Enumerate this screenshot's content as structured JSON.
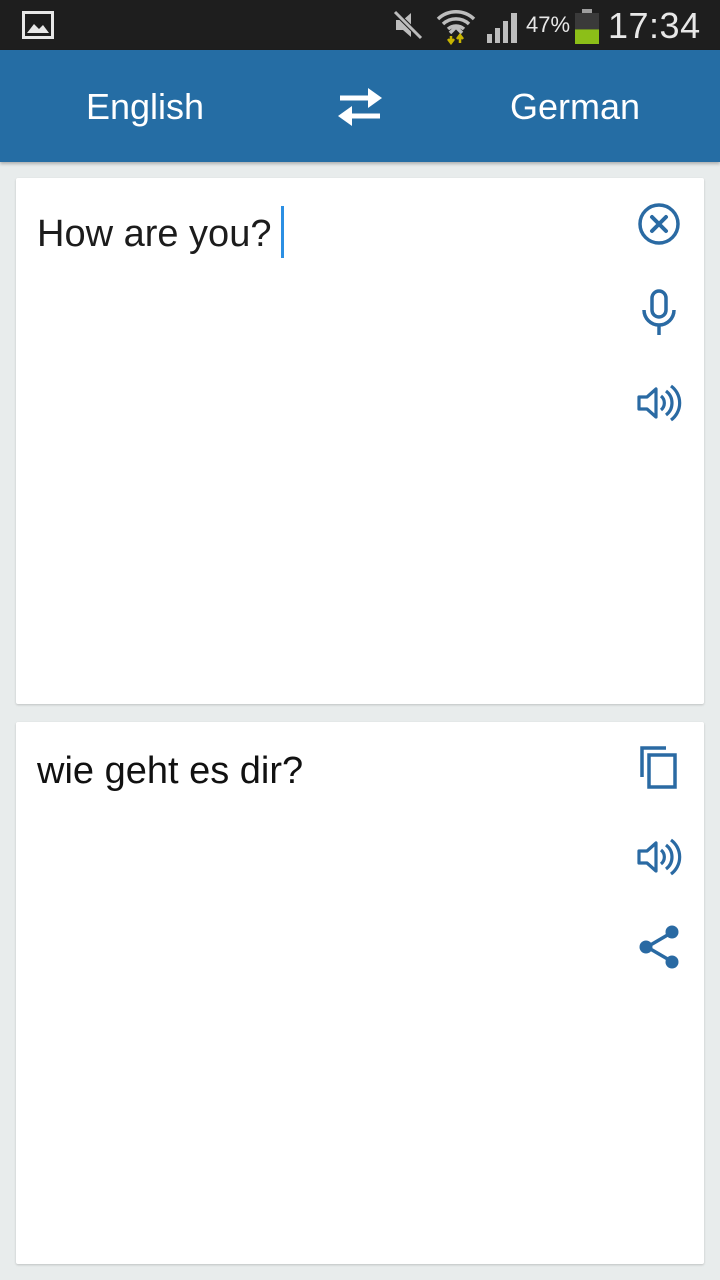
{
  "status_bar": {
    "battery_percent": "47%",
    "time": "17:34",
    "battery_level": 0.47,
    "icons": [
      "gallery-icon",
      "mute-icon",
      "wifi-icon",
      "signal-icon",
      "battery-icon"
    ]
  },
  "toolbar": {
    "source_language": "English",
    "target_language": "German",
    "swap_icon": "swap-arrows-icon"
  },
  "input_card": {
    "text": "How are you?",
    "actions": [
      "clear-icon",
      "microphone-icon",
      "speaker-icon"
    ]
  },
  "output_card": {
    "text": "wie geht es dir?",
    "actions": [
      "copy-icon",
      "speaker-icon",
      "share-icon"
    ]
  },
  "colors": {
    "app_bar": "#256da4",
    "accent_icon": "#2a6aa3",
    "caret": "#2b8fe3",
    "background": "#e8ecec"
  }
}
